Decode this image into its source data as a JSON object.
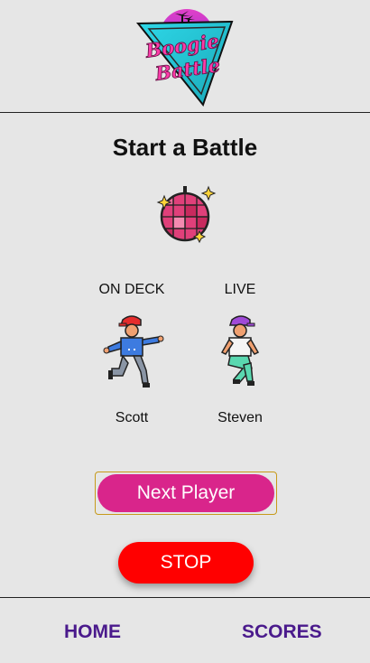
{
  "app": {
    "logo_line1": "Boogie",
    "logo_line2": "Battle",
    "colors": {
      "background": "#e6e6e6",
      "primary": "#d9258b",
      "stop": "#ff0000",
      "nav": "#4a1a8c"
    }
  },
  "main": {
    "title": "Start a Battle",
    "disco_icon": "disco-ball-icon",
    "on_deck": {
      "label": "ON DECK",
      "name": "Scott",
      "icon": "dancer-icon"
    },
    "live": {
      "label": "LIVE",
      "name": "Steven",
      "icon": "dancer-icon"
    },
    "next_button": "Next Player",
    "stop_button": "STOP"
  },
  "footer": {
    "home": "HOME",
    "scores": "SCORES"
  }
}
